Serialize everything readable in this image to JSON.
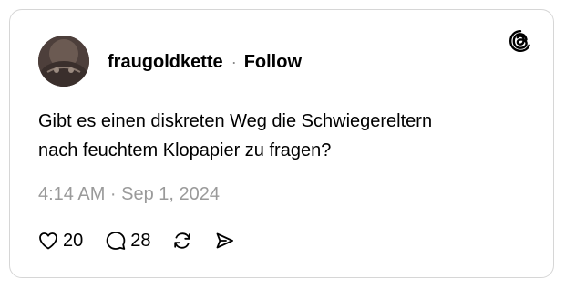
{
  "author": {
    "username": "fraugoldkette",
    "separator": "·",
    "follow_label": "Follow"
  },
  "post": {
    "line1": "Gibt es einen diskreten Weg die Schwiegereltern",
    "line2": "nach feuchtem Klopapier zu fragen?",
    "timestamp": "4:14 AM · Sep 1, 2024"
  },
  "stats": {
    "likes": "20",
    "replies": "28"
  },
  "icons": {
    "logo": "threads-logo-icon",
    "like": "heart-icon",
    "reply": "comment-bubble-icon",
    "repost": "repost-icon",
    "share": "send-icon"
  }
}
